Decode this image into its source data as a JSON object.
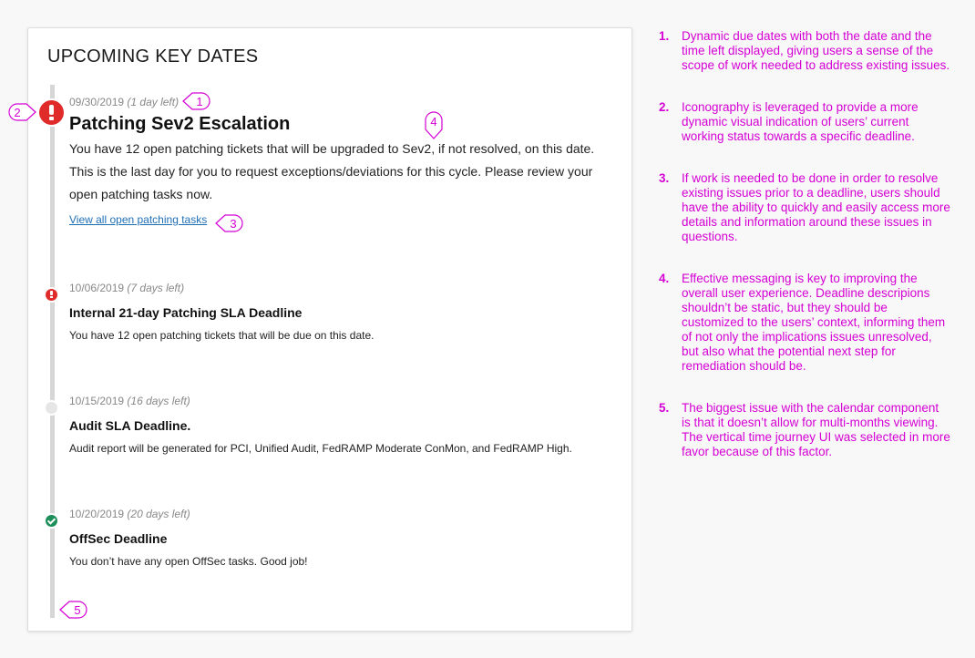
{
  "card": {
    "title": "UPCOMING KEY DATES",
    "events": [
      {
        "date": "09/30/2019",
        "days_left": "(1 day left)",
        "title": "Patching Sev2 Escalation",
        "description": "You have 12 open patching tickets that will be upgraded to Sev2, if not resolved, on this date. This is the last day for you to request exceptions/deviations for this cycle. Please review your open patching tasks now.",
        "link": "View all open patching tasks",
        "status_icon": "alert-icon",
        "status_color": "#e02b2b"
      },
      {
        "date": "10/06/2019",
        "days_left": "(7 days left)",
        "title": "Internal 21-day Patching SLA Deadline",
        "description": "You have 12 open patching tickets that will be due on this date.",
        "status_icon": "alert-icon",
        "status_color": "#e02b2b"
      },
      {
        "date": "10/15/2019",
        "days_left": "(16 days left)",
        "title": "Audit SLA Deadline.",
        "description": "Audit report will be generated for PCI, Unified Audit, FedRAMP Moderate ConMon, and FedRAMP High.",
        "status_icon": "pending-dot-icon",
        "status_color": "#e6e6e6"
      },
      {
        "date": "10/20/2019",
        "days_left": "(20 days left)",
        "title": "OffSec Deadline",
        "description": "You don’t have any open OffSec tasks. Good job!",
        "status_icon": "check-icon",
        "status_color": "#1e8e5a"
      }
    ]
  },
  "callouts": [
    "1",
    "2",
    "3",
    "4",
    "5"
  ],
  "notes": [
    {
      "num": "1.",
      "text": "Dynamic due dates with both the date and the time left displayed, giving users a sense of the scope of work needed to address existing issues."
    },
    {
      "num": "2.",
      "text": "Iconography is leveraged to provide a more dynamic visual indication of users’ current working status towards a specific deadline."
    },
    {
      "num": "3.",
      "text": "If work is needed to be done in order to resolve existing issues prior to a deadline, users should have the ability to quickly and easily access more details and information around these issues in questions."
    },
    {
      "num": "4.",
      "text": "Effective messaging is key to improving the overall user experience. Deadline descripions shouldn’t be static, but they should be customized to the users’ context, informing them of not only the implications issues unresolved, but also what the potential next step for remediation should be."
    },
    {
      "num": "5.",
      "text": "The biggest issue with the calendar component is that it doesn’t allow for multi-months viewing. The vertical time journey UI was selected in more favor because of this factor."
    }
  ],
  "colors": {
    "annotation": "#d400d4",
    "link": "#1f6fb5",
    "alert": "#e02b2b",
    "done": "#1e8e5a"
  }
}
